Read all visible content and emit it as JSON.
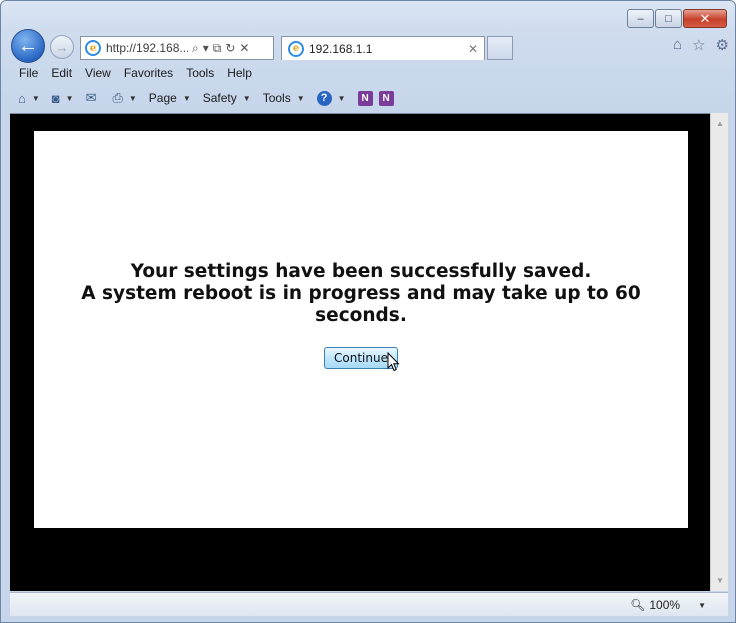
{
  "window": {
    "minimize": "–",
    "maximize": "□",
    "close": "✕"
  },
  "nav": {
    "back": "←",
    "forward": "→",
    "address": "http://192.168...",
    "search_glyph": "⌕",
    "dropdown_glyph": "▾",
    "compat_glyph": "⧉",
    "refresh_glyph": "↻",
    "stop_glyph": "✕"
  },
  "tab": {
    "title": "192.168.1.1",
    "close": "✕"
  },
  "right_icons": {
    "home": "⌂",
    "favorites": "☆",
    "tools": "⚙"
  },
  "menubar": {
    "items": [
      "File",
      "Edit",
      "View",
      "Favorites",
      "Tools",
      "Help"
    ]
  },
  "commandbar": {
    "page_label": "Page",
    "safety_label": "Safety",
    "tools_label": "Tools",
    "onenote_letter": "N",
    "help_glyph": "?"
  },
  "content": {
    "line1": "Your settings have been successfully saved.",
    "line2": "A system reboot is in progress and may take up to 60 seconds.",
    "continue_label": "Continue"
  },
  "statusbar": {
    "zoom_level": "100%"
  },
  "colors": {
    "accent": "#2a68c4",
    "page_background": "#000000",
    "panel_background": "#ffffff"
  }
}
